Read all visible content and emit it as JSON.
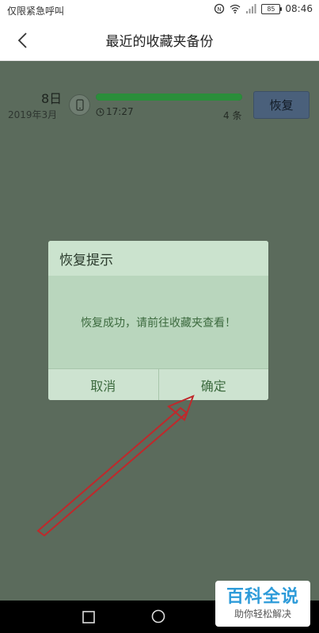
{
  "status_bar": {
    "left_text": "仅限紧急呼叫",
    "battery": "85",
    "time": "08:46"
  },
  "nav": {
    "title": "最近的收藏夹备份",
    "back_icon": "chevron-left-icon"
  },
  "backup": {
    "day": "8日",
    "month": "2019年3月",
    "time": "17:27",
    "count": "4 条",
    "progress": 1.0,
    "restore_label": "恢复",
    "icon": "phone-icon"
  },
  "dialog": {
    "title": "恢复提示",
    "message": "恢复成功，请前往收藏夹查看！",
    "cancel_label": "取消",
    "confirm_label": "确定"
  },
  "watermark": {
    "main": "百科全说",
    "sub": "助你轻松解决"
  },
  "colors": {
    "overlay": "#5b6b5c",
    "dialog_bg": "#b9d6bd",
    "arrow": "#c0282b",
    "progress_fill": "#2a8e3a",
    "watermark_blue": "#2d9bd9"
  }
}
